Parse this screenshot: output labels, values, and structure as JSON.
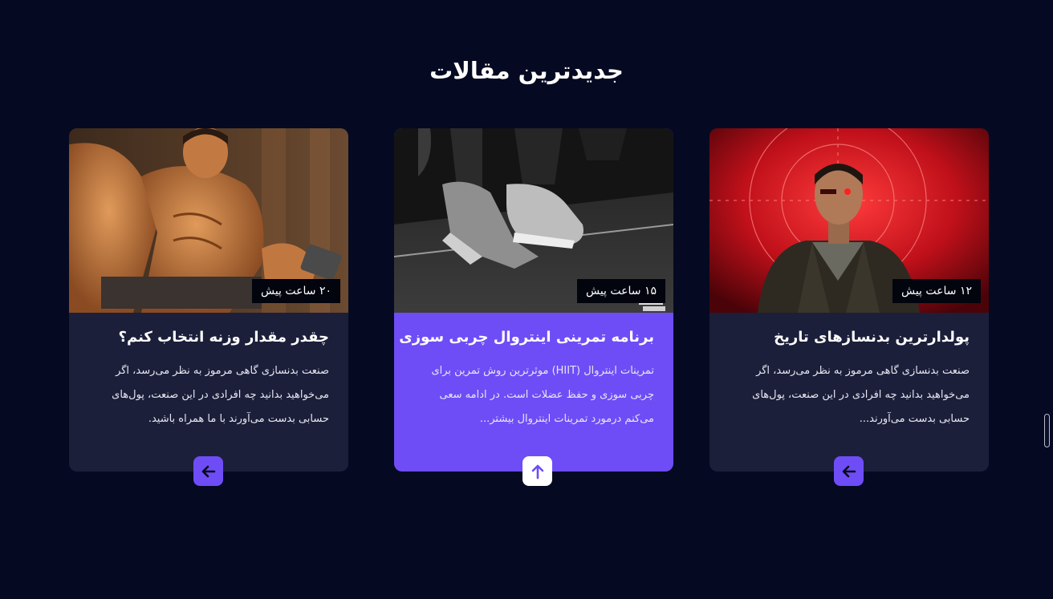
{
  "section": {
    "title": "جدیدترین مقالات"
  },
  "articles": [
    {
      "time": "۱۲ ساعت پیش",
      "title": "پولدارترین بدنسازهای تاریخ",
      "excerpt": "صنعت بدنسازی گاهی مرموز به نظر می‌رسد، اگر می‌خواهید بدانید چه افرادی در این صنعت، پول‌های حسابی بدست می‌آورند...",
      "button_icon": "arrow-left-icon"
    },
    {
      "time": "۱۵ ساعت پیش",
      "title": "برنامه تمرینی اینتروال چربی سوزی",
      "excerpt": "تمرینات اینتروال (HIIT) موثرترین روش تمرین برای چربی سوزی و حفظ عضلات است. در ادامه سعی می‌کنم درمورد تمرینات اینتروال بیشتر...",
      "button_icon": "arrow-up-icon"
    },
    {
      "time": "۲۰ ساعت پیش",
      "title": "چقدر مقدار وزنه انتخاب کنم؟",
      "excerpt": "صنعت بدنسازی گاهی مرموز به نظر می‌رسد، اگر می‌خواهید بدانید چه افرادی در این صنعت، پول‌های حسابی بدست می‌آورند با ما همراه باشید.",
      "button_icon": "arrow-left-icon"
    }
  ],
  "colors": {
    "background": "#050a22",
    "card": "#1c1f3a",
    "accent": "#6e4df7",
    "badge": "#02040e"
  }
}
